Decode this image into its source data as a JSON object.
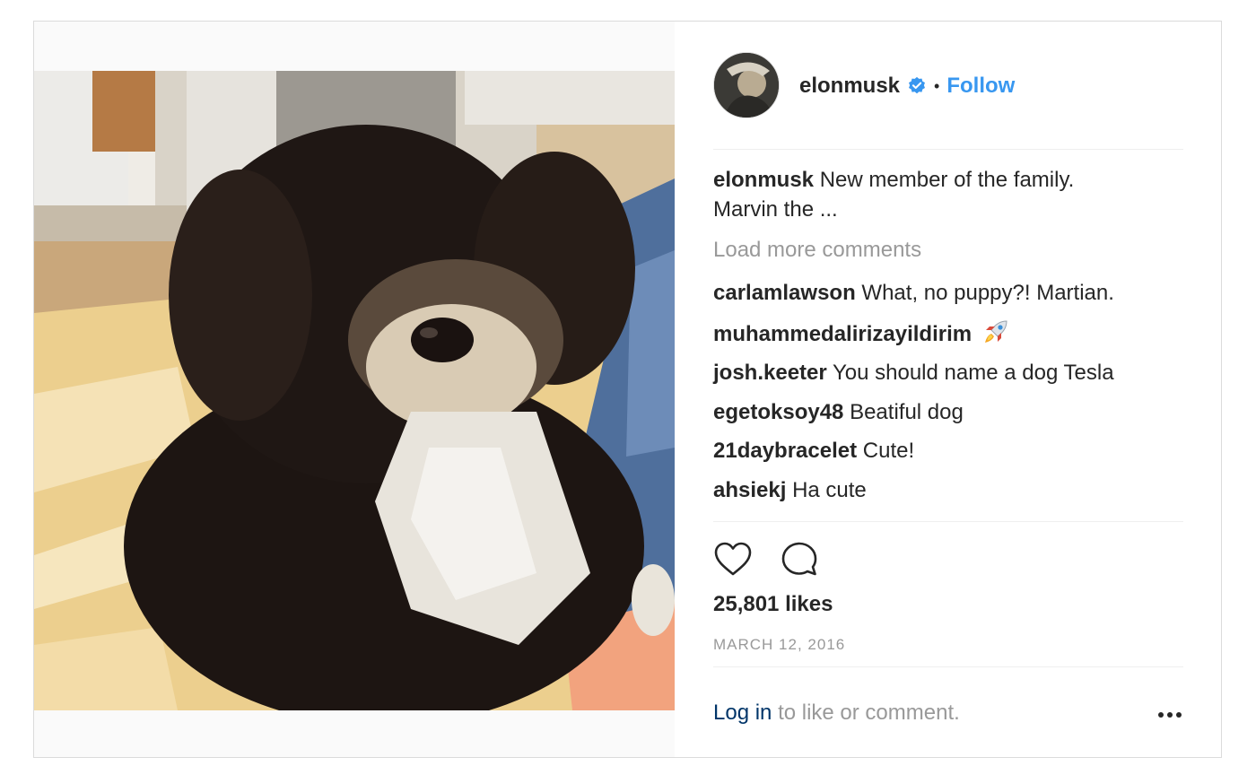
{
  "post": {
    "username": "elonmusk",
    "dot": "•",
    "follow_label": "Follow",
    "caption_username": "elonmusk",
    "caption_text": "New member of the family.",
    "caption_more": "Marvin the ...",
    "load_more_label": "Load more comments",
    "comments": [
      {
        "user": "carlamlawson",
        "text": "What, no puppy?! Martian."
      },
      {
        "user": "muhammedalirizayildirim",
        "text": "",
        "icon": "rocket-icon"
      },
      {
        "user": "josh.keeter",
        "text": "You should name a dog Tesla"
      },
      {
        "user": "egetoksoy48",
        "text": "Beatiful dog"
      },
      {
        "user": "21daybracelet",
        "text": "Cute!"
      },
      {
        "user": "ahsiekj",
        "text": "Ha cute"
      }
    ],
    "likes": "25,801 likes",
    "date": "MARCH 12, 2016",
    "login_label": "Log in",
    "login_suffix": "to like or comment.",
    "icons": {
      "verified": "verified-badge-icon",
      "like": "heart-icon",
      "comment": "comment-icon",
      "more": "more-options-icon"
    },
    "colors": {
      "follow": "#3897f0",
      "login": "#003569",
      "muted": "#999999",
      "text": "#262626"
    }
  }
}
